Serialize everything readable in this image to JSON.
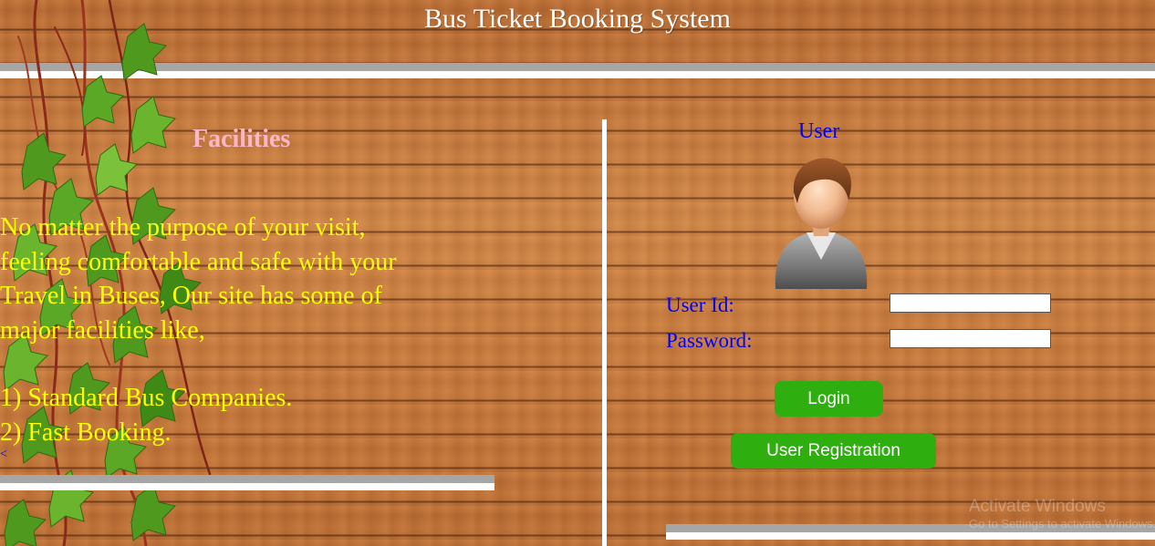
{
  "header": {
    "title": "Bus Ticket Booking System"
  },
  "facilities": {
    "heading": "Facilities",
    "intro_lines": [
      "No matter the purpose of your visit,",
      "feeling comfortable and safe with your",
      "Travel in Buses, Our site has some of",
      "major facilities like,"
    ],
    "items": [
      "1) Standard Bus Companies.",
      "2) Fast Booking."
    ],
    "link_fragment": "<"
  },
  "login": {
    "heading": "User",
    "avatar_icon": "user-avatar-icon",
    "user_id_label": "User Id:",
    "user_id_value": "",
    "password_label": "Password:",
    "password_value": "",
    "login_button": "Login",
    "register_button": "User Registration"
  },
  "watermark": {
    "line1": "Activate Windows",
    "line2": "Go to Settings to activate Windows."
  },
  "colors": {
    "title": "#ffffff",
    "facilities_heading": "#ffb6c8",
    "facilities_text": "#ffff00",
    "form_text": "#0000ff",
    "button_bg": "#2fae10",
    "rule_top": "#a6a6a6",
    "rule_bottom": "#ffffff"
  }
}
